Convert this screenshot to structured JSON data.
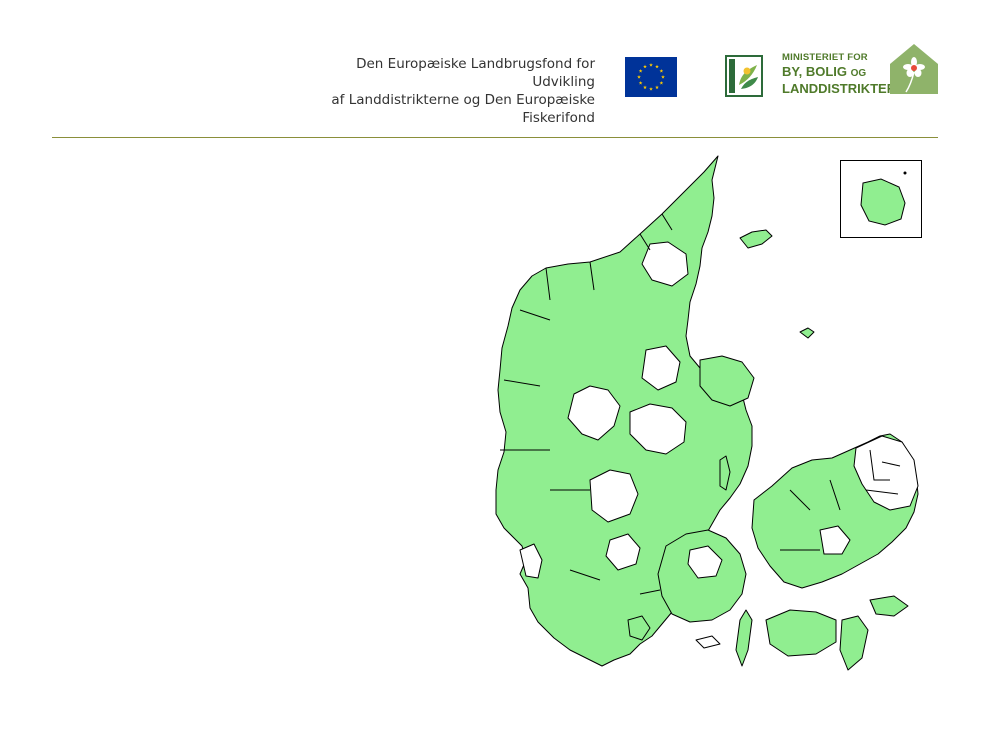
{
  "header": {
    "fund_line1": "Den Europæiske Landbrugsfond for Udvikling",
    "fund_line2": "af Landdistrikterne og Den Europæiske Fiskerifond",
    "eu_flag_icon": "eu-flag-icon",
    "leader_logo_icon": "leader-logo-icon",
    "ministry": {
      "line1": "MINISTERIET FOR",
      "line2": "BY, BOLIG",
      "line2_suffix": "OG",
      "line3": "LANDDISTRIKTER",
      "icon": "house-flower-icon"
    },
    "colors": {
      "eu_blue": "#003399",
      "eu_gold": "#ffcc00",
      "ministry_green": "#4f7a2a",
      "house_green": "#8fb36a",
      "divider": "#8a8f3a"
    }
  },
  "map": {
    "legend_colors": {
      "covered_area": "#90ee90",
      "uncovered_area": "#ffffff",
      "border": "#000000"
    },
    "inset": "bornholm-inset"
  }
}
